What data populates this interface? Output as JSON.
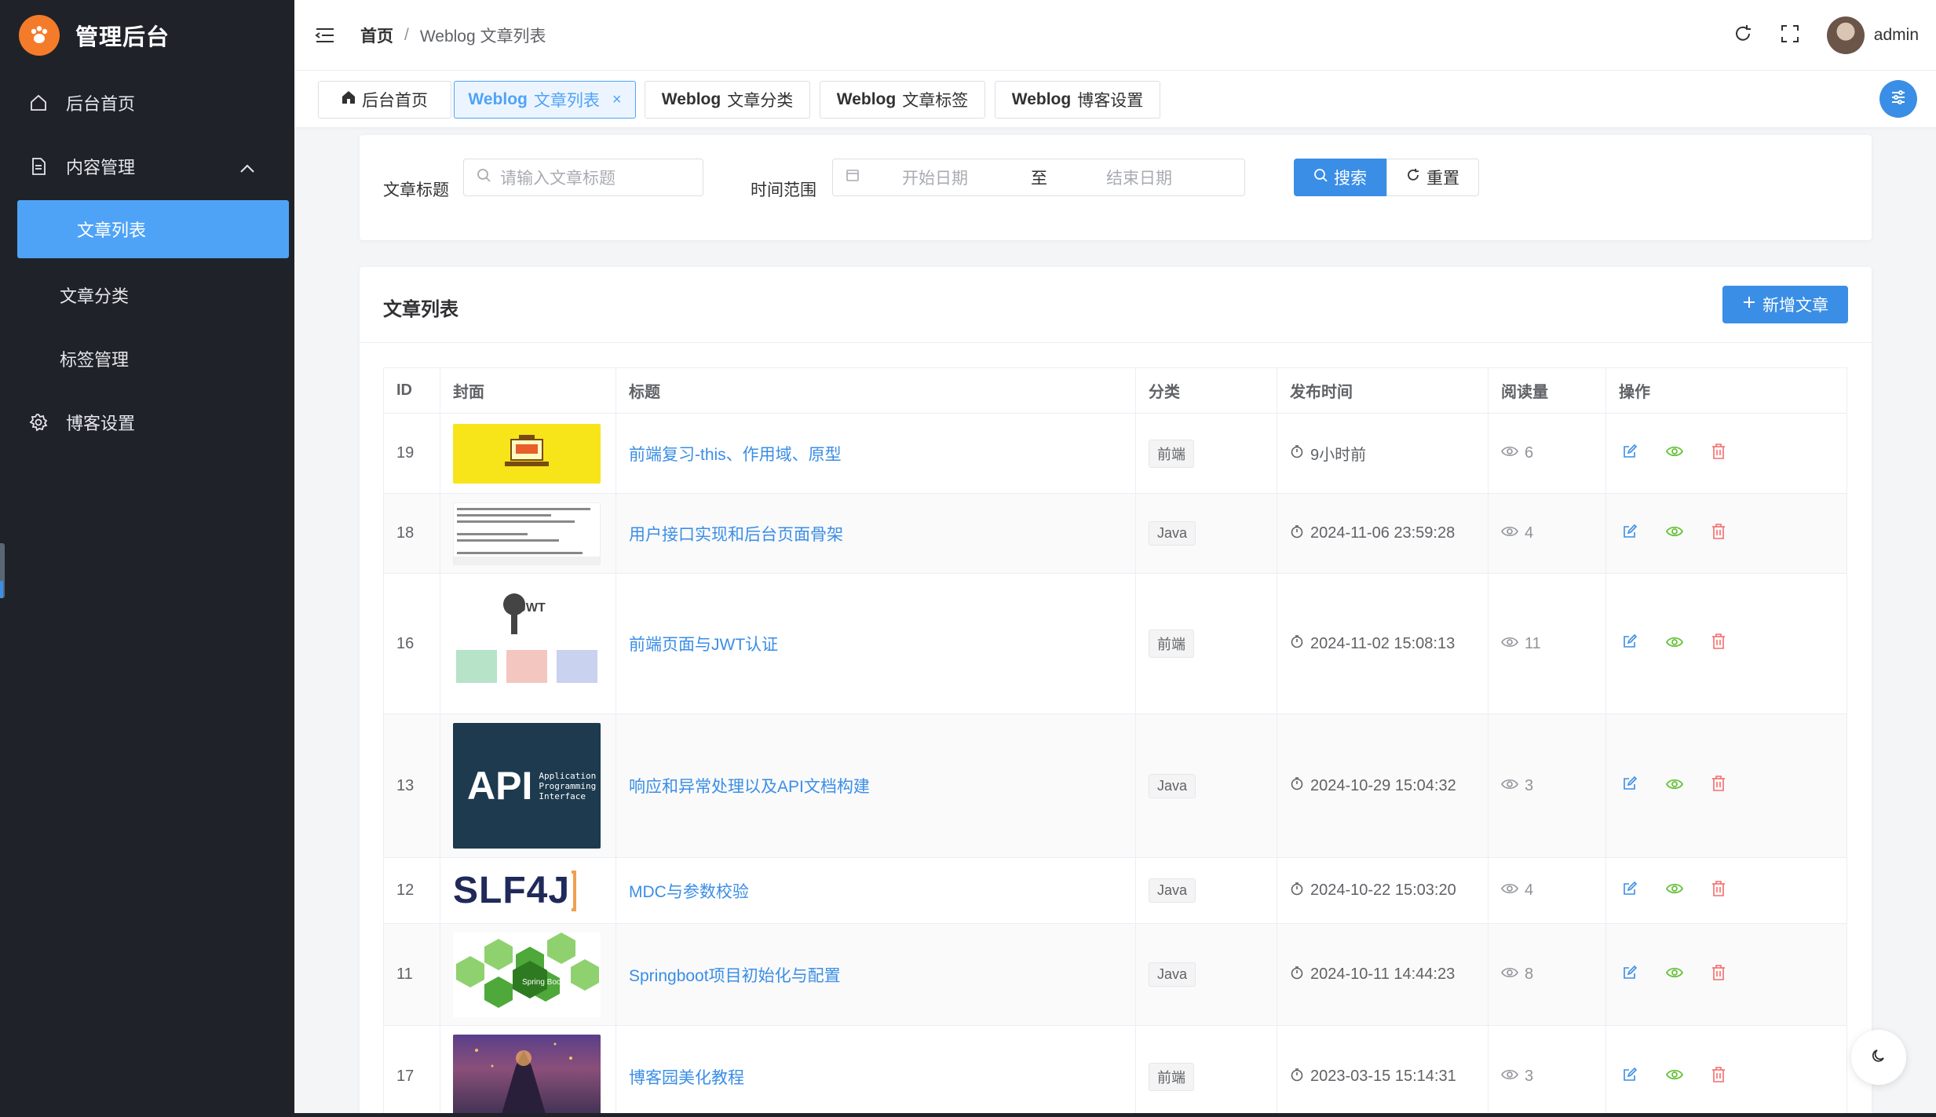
{
  "brand": {
    "title": "管理后台",
    "logo_icon": "paw-icon"
  },
  "sidebar": {
    "items": [
      {
        "label": "后台首页",
        "icon": "home-icon"
      },
      {
        "label": "内容管理",
        "icon": "document-icon",
        "expanded": true
      },
      {
        "label": "文章列表",
        "active": true
      },
      {
        "label": "文章分类"
      },
      {
        "label": "标签管理"
      },
      {
        "label": "博客设置",
        "icon": "gear-icon"
      }
    ]
  },
  "header": {
    "breadcrumb_home": "首页",
    "breadcrumb_sep": "/",
    "breadcrumb_current": "Weblog 文章列表",
    "username": "admin"
  },
  "tabs": [
    {
      "label": "后台首页",
      "icon": "home-icon"
    },
    {
      "prefix": "Weblog",
      "label": "文章列表",
      "active": true,
      "close": "×"
    },
    {
      "prefix": "Weblog",
      "label": "文章分类"
    },
    {
      "prefix": "Weblog",
      "label": "文章标签"
    },
    {
      "prefix": "Weblog",
      "label": "博客设置"
    }
  ],
  "search": {
    "title_label": "文章标题",
    "title_placeholder": "请输入文章标题",
    "range_label": "时间范围",
    "start_placeholder": "开始日期",
    "range_sep": "至",
    "end_placeholder": "结束日期",
    "search_btn": "搜索",
    "reset_btn": "重置"
  },
  "list": {
    "title": "文章列表",
    "add_btn": "新增文章",
    "columns": [
      "ID",
      "封面",
      "标题",
      "分类",
      "发布时间",
      "阅读量",
      "操作"
    ],
    "rows": [
      {
        "id": "19",
        "title": "前端复习-this、作用域、原型",
        "category": "前端",
        "time": "9小时前",
        "reads": "6"
      },
      {
        "id": "18",
        "title": "用户接口实现和后台页面骨架",
        "category": "Java",
        "time": "2024-11-06 23:59:28",
        "reads": "4"
      },
      {
        "id": "16",
        "title": "前端页面与JWT认证",
        "category": "前端",
        "time": "2024-11-02 15:08:13",
        "reads": "11"
      },
      {
        "id": "13",
        "title": "响应和异常处理以及API文档构建",
        "category": "Java",
        "time": "2024-10-29 15:04:32",
        "reads": "3"
      },
      {
        "id": "12",
        "title": "MDC与参数校验",
        "category": "Java",
        "time": "2024-10-22 15:03:20",
        "reads": "4"
      },
      {
        "id": "11",
        "title": "Springboot项目初始化与配置",
        "category": "Java",
        "time": "2024-10-11 14:44:23",
        "reads": "8"
      },
      {
        "id": "17",
        "title": "博客园美化教程",
        "category": "前端",
        "time": "2023-03-15 15:14:31",
        "reads": "3"
      }
    ],
    "cover_texts": {
      "jwt": "JWT",
      "api": "API",
      "api_sub": "Application Programming Interface",
      "slf4j": "SLF4J",
      "springboot": "Spring Boot"
    }
  },
  "colors": {
    "primary": "#3a8ee6",
    "sidebar_bg": "#1f2329",
    "active_item": "#4fa3f7",
    "view": "#67c23a",
    "delete": "#f56c6c"
  }
}
